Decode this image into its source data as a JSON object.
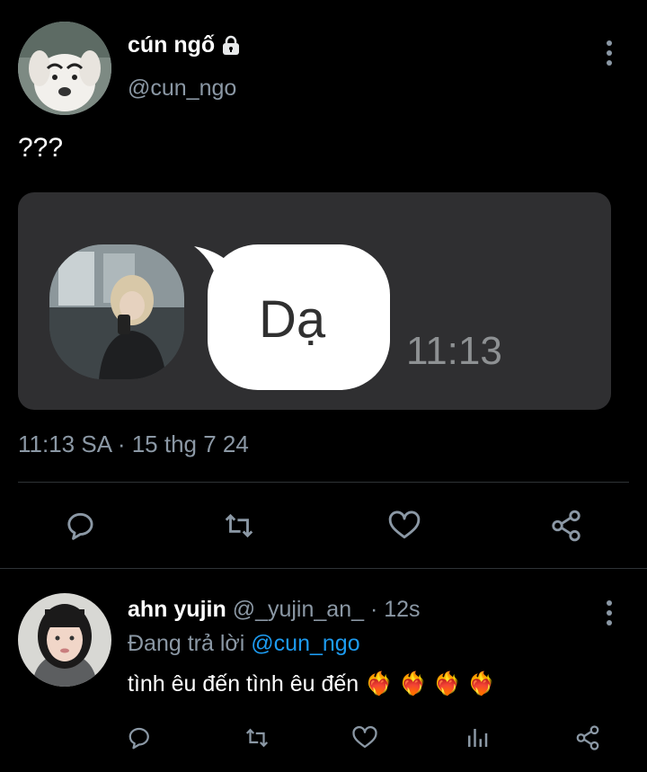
{
  "tweet": {
    "author_name": "cún ngố",
    "author_handle": "@cun_ngo",
    "text": "???",
    "media": {
      "bubble_text": "Dạ",
      "bubble_time": "11:13"
    },
    "timestamp": "11:13 SA · 15 thg 7 24",
    "actions": [
      "reply-icon",
      "retweet-icon",
      "like-icon",
      "share-icon"
    ]
  },
  "reply": {
    "author_name": "ahn yujin",
    "author_handle": "@_yujin_an_",
    "age": "· 12s",
    "replying_prefix": "Đang trả lời",
    "replying_to": "@cun_ngo",
    "text": "tình êu đến tình êu đến",
    "emoji": "❤️‍🔥 ❤️‍🔥 ❤️‍🔥 ❤️‍🔥",
    "actions": [
      "reply-icon",
      "retweet-icon",
      "like-icon",
      "views-icon",
      "share-icon"
    ]
  },
  "colors": {
    "background": "#000000",
    "text": "#e7e9ea",
    "muted": "#8b98a5",
    "link": "#1d9bf0",
    "card": "#2f2f31"
  }
}
